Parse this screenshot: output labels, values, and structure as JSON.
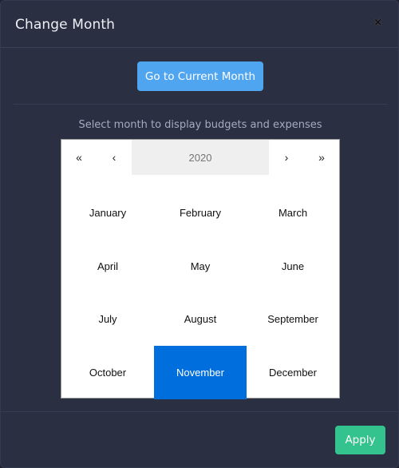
{
  "modal": {
    "title": "Change Month",
    "close_icon": "×",
    "current_month_button": "Go to Current Month",
    "hint": "Select month to display budgets and expenses",
    "apply_button": "Apply"
  },
  "picker": {
    "nav": {
      "prev_year": "«",
      "prev": "‹",
      "next": "›",
      "next_year": "»"
    },
    "year": "2020",
    "months": [
      "January",
      "February",
      "March",
      "April",
      "May",
      "June",
      "July",
      "August",
      "September",
      "October",
      "November",
      "December"
    ],
    "selected": "November"
  },
  "colors": {
    "primary": "#50a5f1",
    "success": "#34c38f",
    "selected": "#006edc"
  }
}
